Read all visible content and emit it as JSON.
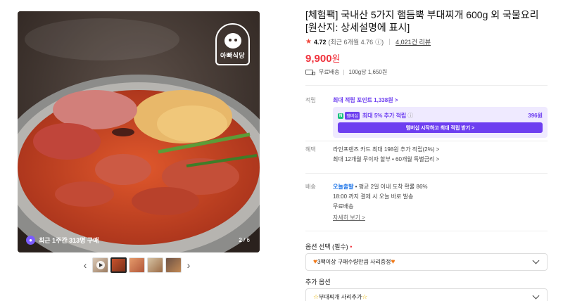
{
  "gallery": {
    "brand_logo_name": "아빠식당",
    "recent_buyers": "최근 1주간 313명 구매",
    "page_current": "2",
    "page_total": "/ 6",
    "prev_icon": "chevron-left-icon",
    "next_icon": "chevron-right-icon",
    "thumbnail_count": 5
  },
  "product": {
    "title": "[체험팩] 국내산 5가지 햄듬뿍 부대찌개 600g 외 국물요리 [원산지: 상세설명에 표시]",
    "rating_score": "4.72",
    "rating_detail": "(최근 6개월 4.76",
    "review_count": "4,021건 리뷰",
    "price_value": "9,900",
    "price_unit": "원",
    "shipping": "무료배송",
    "unit_price": "100g당 1,650원"
  },
  "points": {
    "label": "적립",
    "max_points": "최대 적립 포인트 1,338원 >",
    "npay_logo": "N",
    "membership_logo": "멤버십",
    "extra_text": "최대 5% 추가 적립",
    "extra_amount": "396원",
    "cta": "멤버십 시작하고 최대 적립 받기 >"
  },
  "benefits": {
    "label": "혜택",
    "card": "라인프렌즈 카드 최대 198원 추가 적립(2%) >",
    "installment": "최대 12개월 무이자 할부 • 60개월 특별금리 >"
  },
  "delivery": {
    "label": "배송",
    "fast": "오늘출발",
    "fast_detail": " • 평균 2일 이내 도착 확률 86%",
    "cutoff": "18:00 까지 결제 시 오늘 바로 발송",
    "fee": "무료배송",
    "more": "자세히 보기 >"
  },
  "options": {
    "required_label": "옵션 선택 (필수)",
    "required_mark": "•",
    "required_value": "3팩이상 구매수량만큼 사리증정",
    "extra_label": "추가 옵션",
    "extra_value": "부대찌개 사리추가"
  },
  "colors": {
    "accent_purple": "#6d3ef0",
    "price_red": "#f0323c",
    "fast_blue": "#1a73e8"
  }
}
